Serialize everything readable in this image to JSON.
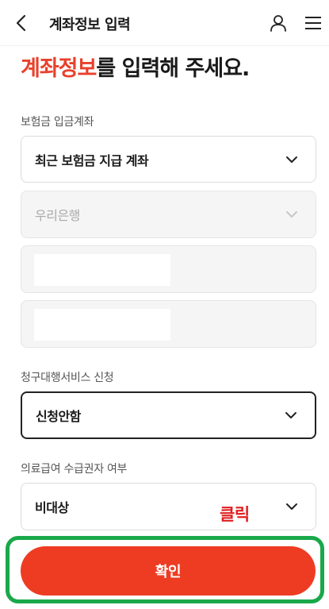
{
  "header": {
    "title": "계좌정보 입력",
    "back_icon": "chevron-left-icon",
    "user_icon": "user-icon",
    "menu_icon": "hamburger-menu-icon"
  },
  "headline": {
    "accent": "계좌정보",
    "rest": "를 입력해 주세요."
  },
  "sections": {
    "account_label": "보험금 입금계좌",
    "account_select": "최근 보험금 지급 계좌",
    "bank_select": "우리은행",
    "claim_service_label": "청구대행서비스 신청",
    "claim_service_select": "신청안함",
    "medical_aid_label": "의료급여 수급권자 여부",
    "medical_aid_select": "비대상"
  },
  "annotation": {
    "click_note": "클릭"
  },
  "footer": {
    "confirm_label": "확인"
  },
  "colors": {
    "accent": "#e8412c",
    "button": "#ee3c23",
    "highlight": "#1aa84a",
    "note": "#e02020"
  }
}
